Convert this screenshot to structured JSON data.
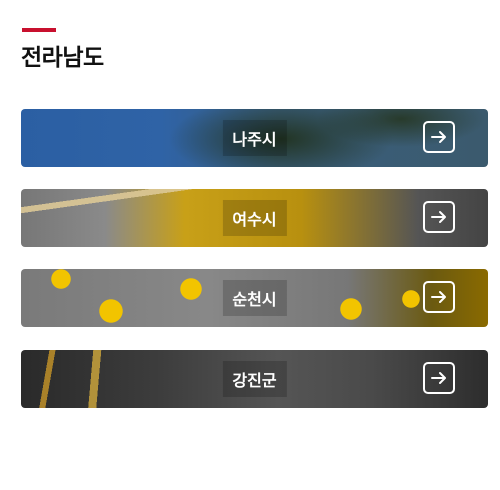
{
  "page": {
    "title": "전라남도"
  },
  "cities": [
    {
      "label": "나주시"
    },
    {
      "label": "여수시"
    },
    {
      "label": "순천시"
    },
    {
      "label": "강진군"
    }
  ],
  "icons": {
    "arrow": "arrow-right-icon"
  },
  "colors": {
    "accent": "#c8102e"
  }
}
